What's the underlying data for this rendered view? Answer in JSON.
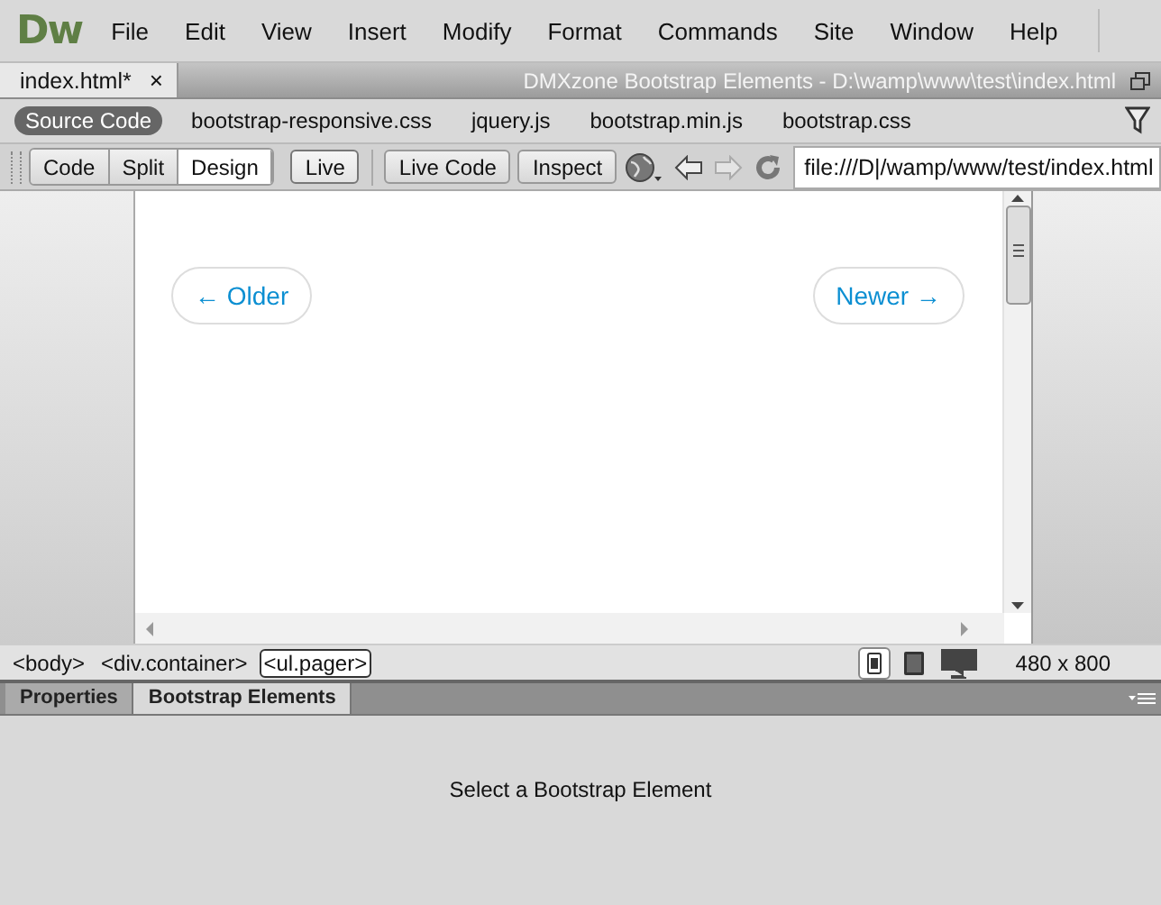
{
  "app": {
    "logo": "Dw",
    "menu": [
      "File",
      "Edit",
      "View",
      "Insert",
      "Modify",
      "Format",
      "Commands",
      "Site",
      "Window",
      "Help"
    ]
  },
  "document_tab": {
    "label": "index.html*",
    "close": "×"
  },
  "title_path": "DMXzone Bootstrap Elements - D:\\wamp\\www\\test\\index.html",
  "related_files": [
    {
      "label": "Source Code",
      "selected": true
    },
    {
      "label": "bootstrap-responsive.css",
      "selected": false
    },
    {
      "label": "jquery.js",
      "selected": false
    },
    {
      "label": "bootstrap.min.js",
      "selected": false
    },
    {
      "label": "bootstrap.css",
      "selected": false
    }
  ],
  "view_buttons": [
    {
      "label": "Code",
      "selected": false
    },
    {
      "label": "Split",
      "selected": false
    },
    {
      "label": "Design",
      "selected": true
    },
    {
      "label": "Live",
      "selected": false
    }
  ],
  "tool_buttons": [
    "Live Code",
    "Inspect"
  ],
  "address": {
    "value": "file:///D|/wamp/www/test/index.html"
  },
  "pager": [
    "← Older",
    "Newer →"
  ],
  "tag_selector": [
    {
      "label": "<body>",
      "selected": false
    },
    {
      "label": "<div.container>",
      "selected": false
    },
    {
      "label": "<ul.pager>",
      "selected": true
    }
  ],
  "device_sizes": [
    {
      "kind": "phone",
      "selected": true
    },
    {
      "kind": "tablet",
      "selected": false
    },
    {
      "kind": "desktop",
      "selected": false
    }
  ],
  "window_size": "480 x 800",
  "panel_tabs": [
    {
      "label": "Properties",
      "selected": false
    },
    {
      "label": "Bootstrap Elements",
      "selected": true
    }
  ],
  "panel_message": "Select a Bootstrap Element"
}
